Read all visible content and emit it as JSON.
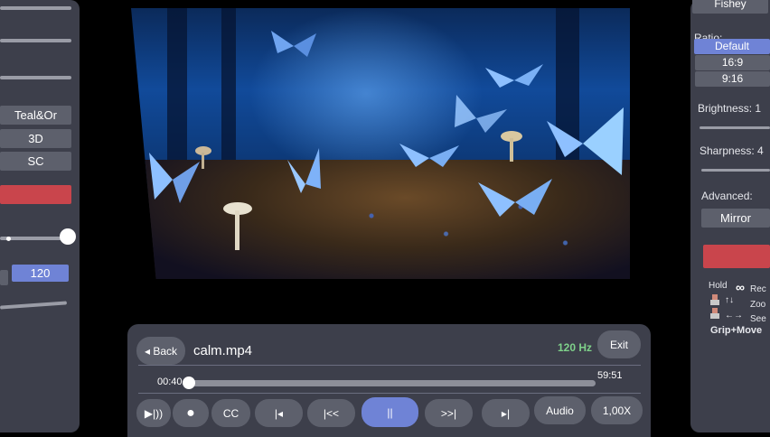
{
  "left_panel": {
    "buttons": [
      "Teal&Or",
      "3D",
      "SC"
    ],
    "refresh_value": "120"
  },
  "video": {
    "scene": "butterflies-and-mushrooms-forest"
  },
  "player": {
    "back_label": "◂ Back",
    "file_name": "calm.mp4",
    "refresh_rate": "120 Hz",
    "exit_label": "Exit",
    "current_time": "00:40",
    "total_time": "59:51",
    "progress_fraction": 0.0,
    "controls": {
      "play_mode": "▶|))",
      "record": "●",
      "cc": "CC",
      "prev": "|◂",
      "rewind": "|<<",
      "pause": "||",
      "forward": ">>|",
      "next": "▸|",
      "audio": "Audio",
      "speed": "1,00X"
    }
  },
  "right_panel": {
    "top_button": "Fishey",
    "ratio_label": "Ratio:",
    "ratio_options": [
      "Default",
      "16:9",
      "9:16"
    ],
    "selected_ratio": "Default",
    "brightness_label": "Brightness: 1",
    "sharpness_label": "Sharpness: 4",
    "advanced_label": "Advanced:",
    "mirror_label": "Mirror",
    "hint_hold": "Hold",
    "hint_rec": "Rec",
    "hint_zoom": "Zoo",
    "hint_seek": "See",
    "hint_arrows_ud": "↑↓",
    "hint_arrows_lr": "←→",
    "hint_grip": "Grip+Move"
  },
  "colors": {
    "panel_bg": "#3d3f4b",
    "button_bg": "#5d606c",
    "accent_blue": "#6f83d6",
    "accent_red": "#c9454c",
    "hz_green": "#7fd18a"
  }
}
